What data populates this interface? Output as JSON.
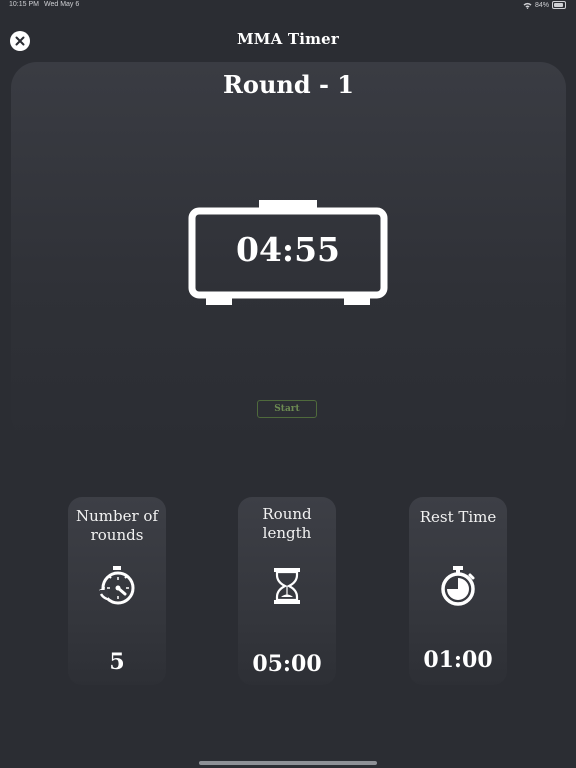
{
  "status_bar": {
    "time": "10:15 PM",
    "date": "Wed May 6",
    "battery": "84%"
  },
  "header": {
    "title": "MMA Timer",
    "close_icon": "close-icon"
  },
  "timer": {
    "round_label": "Round - 1",
    "time_display": "04:55",
    "start_label": "Start"
  },
  "settings": [
    {
      "label_line1": "Number of",
      "label_line2": "rounds",
      "icon": "stopwatch-reset-icon",
      "value": "5"
    },
    {
      "label_line1": "Round",
      "label_line2": "length",
      "icon": "hourglass-icon",
      "value": "05:00"
    },
    {
      "label_line1": "Rest Time",
      "label_line2": "",
      "icon": "stopwatch-icon",
      "value": "01:00"
    }
  ],
  "colors": {
    "background": "#2b2d33",
    "card": "#3a3c43",
    "start_border": "#4f6a3c",
    "start_text": "#6c8a52"
  }
}
